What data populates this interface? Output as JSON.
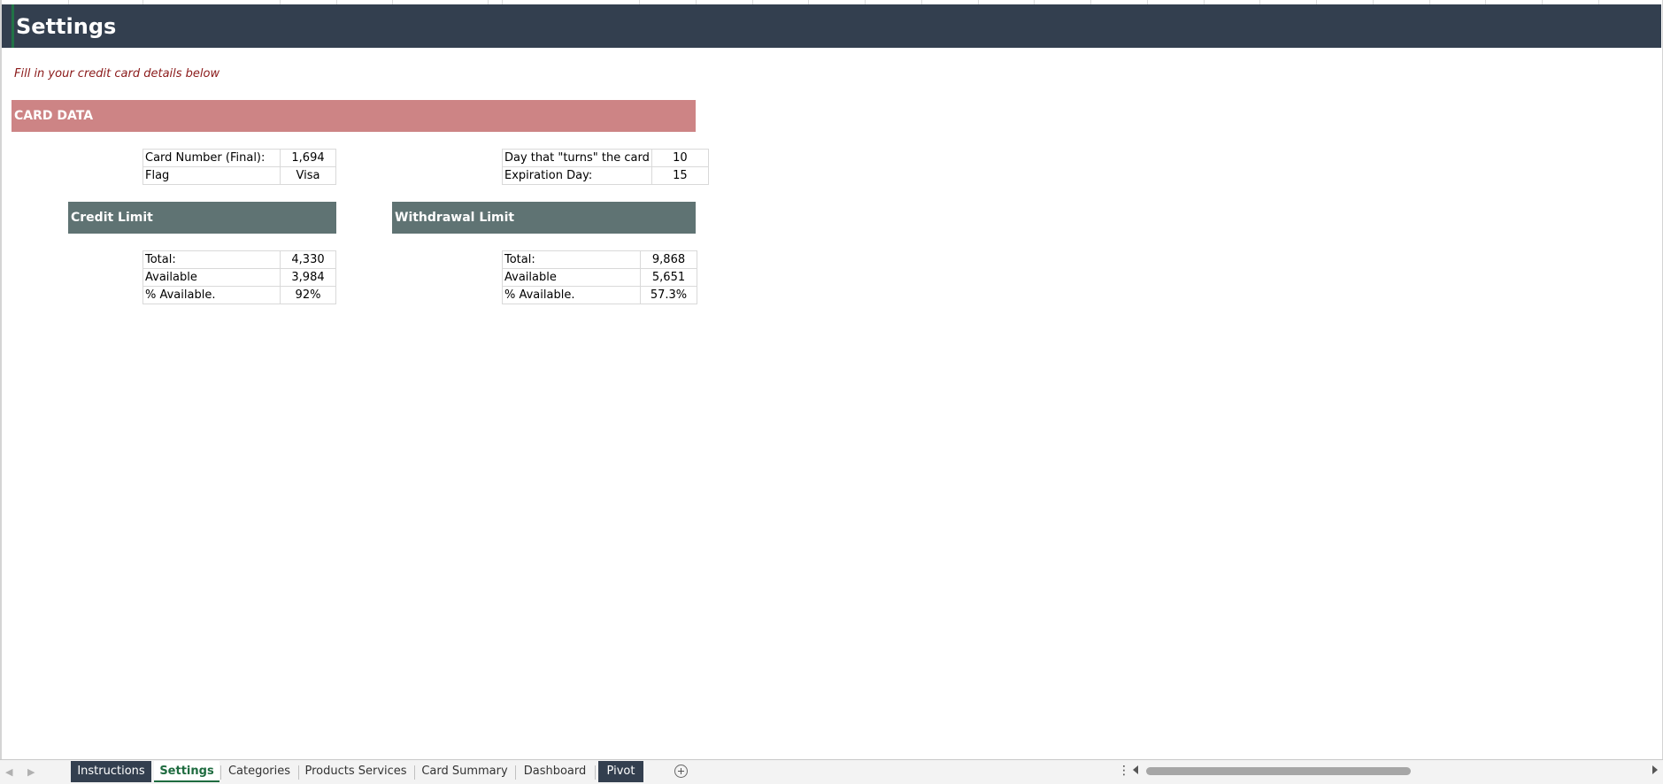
{
  "sheet": {
    "title": "Settings",
    "subtitle": "Fill in your credit card details below"
  },
  "card_data": {
    "header": "CARD DATA",
    "left_rows": [
      {
        "label": "Card Number (Final):",
        "value": "1,694"
      },
      {
        "label": "Flag",
        "value": "Visa"
      }
    ],
    "right_rows": [
      {
        "label": "Day that \"turns\" the card",
        "value": "10"
      },
      {
        "label": "Expiration Day:",
        "value": "15"
      }
    ]
  },
  "credit_limit": {
    "header": "Credit Limit",
    "rows": [
      {
        "label": "Total:",
        "value": "4,330"
      },
      {
        "label": "Available",
        "value": "3,984"
      },
      {
        "label": "% Available.",
        "value": "92%"
      }
    ]
  },
  "withdrawal_limit": {
    "header": "Withdrawal Limit",
    "rows": [
      {
        "label": "Total:",
        "value": "9,868"
      },
      {
        "label": "Available",
        "value": "5,651"
      },
      {
        "label": "% Available.",
        "value": "57.3%"
      }
    ]
  },
  "tabs": [
    {
      "label": "Instructions",
      "style": "dark"
    },
    {
      "label": "Settings",
      "style": "active"
    },
    {
      "label": "Categories",
      "style": "normal"
    },
    {
      "label": "Products Services",
      "style": "normal"
    },
    {
      "label": "Card Summary",
      "style": "normal"
    },
    {
      "label": "Dashboard",
      "style": "normal"
    },
    {
      "label": "Pivot",
      "style": "dark"
    }
  ],
  "colors": {
    "title_bar": "#333f4f",
    "card_band": "#cd8485",
    "limit_band": "#5f7373",
    "subtitle_text": "#8b1a1a",
    "active_tab": "#1e6b3f"
  },
  "icons": {
    "add_sheet": "plus-circle-icon",
    "more": "kebab-icon",
    "scroll_left": "triangle-left-icon",
    "scroll_right": "triangle-right-icon"
  }
}
